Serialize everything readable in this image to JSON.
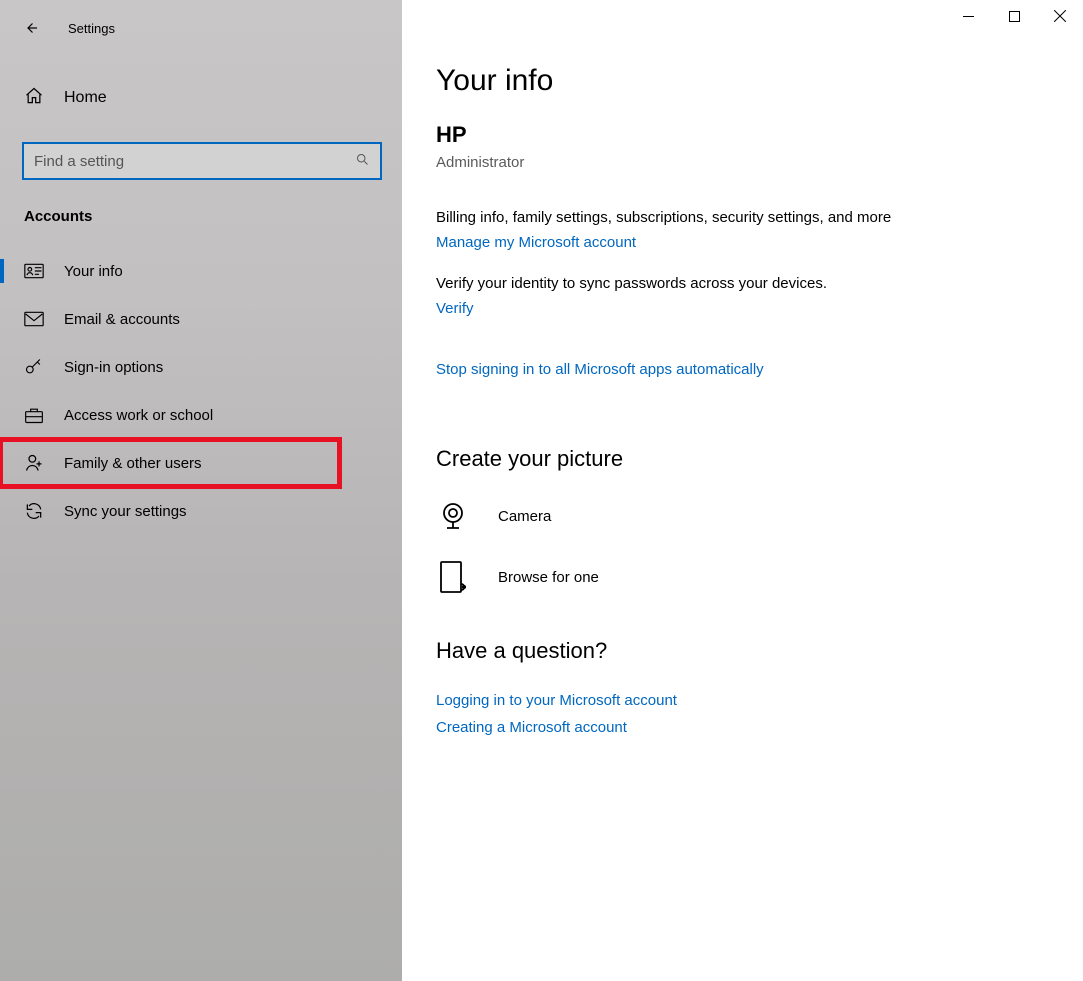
{
  "app_title": "Settings",
  "home_label": "Home",
  "search": {
    "placeholder": "Find a setting"
  },
  "section_header": "Accounts",
  "nav_items": [
    {
      "label": "Your info"
    },
    {
      "label": "Email & accounts"
    },
    {
      "label": "Sign-in options"
    },
    {
      "label": "Access work or school"
    },
    {
      "label": "Family & other users"
    },
    {
      "label": "Sync your settings"
    }
  ],
  "page": {
    "title": "Your info",
    "user_name": "HP",
    "user_email": " ",
    "user_role": "Administrator",
    "billing_text": "Billing info, family settings, subscriptions, security settings, and more",
    "manage_link": "Manage my Microsoft account",
    "verify_text": "Verify your identity to sync passwords across your devices.",
    "verify_link": "Verify",
    "stop_link": "Stop signing in to all Microsoft apps automatically",
    "picture_heading": "Create your picture",
    "camera_label": "Camera",
    "browse_label": "Browse for one",
    "question_heading": "Have a question?",
    "help_links": [
      "Logging in to your Microsoft account",
      "Creating a Microsoft account"
    ]
  }
}
